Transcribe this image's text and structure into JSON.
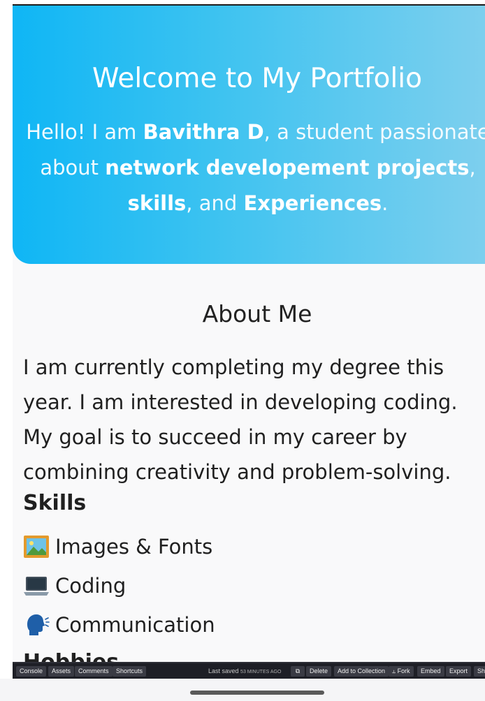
{
  "hero": {
    "title": "Welcome to My Portfolio",
    "intro": {
      "p1": "Hello! I am ",
      "name": "Bavithra D",
      "p2": ", a student passionate",
      "p3": "about ",
      "projects": "network developement projects",
      "p4": ",",
      "skills": "skills",
      "p5": ", and ",
      "experiences": "Experiences",
      "p6": "."
    }
  },
  "about": {
    "title": "About Me",
    "lines": [
      "I am currently completing my degree this",
      "year. I am interested in developing coding.",
      "My goal is to succeed in my career by",
      "combining creativity and problem-solving."
    ]
  },
  "skills": {
    "title": "Skills",
    "items": [
      {
        "icon": "framed-picture-icon",
        "label": "Images & Fonts"
      },
      {
        "icon": "laptop-icon",
        "label": "Coding"
      },
      {
        "icon": "speaking-head-icon",
        "label": "Communication"
      }
    ]
  },
  "hobbies_title": "Hobbies",
  "toolbar": {
    "console": "Console",
    "assets": "Assets",
    "comments": "Comments",
    "shortcuts": "Shortcuts",
    "last_saved": "Last saved",
    "saved_time": "53 MINUTES AGO",
    "delete": "Delete",
    "add_to_collection": "Add to Collection",
    "fork": "Fork",
    "embed": "Embed",
    "export": "Export",
    "share": "Share"
  },
  "colors": {
    "hero_gradient_start": "#0fb6f5",
    "hero_gradient_end": "#7dcfee",
    "toolbar_bg": "#1e1f26"
  }
}
